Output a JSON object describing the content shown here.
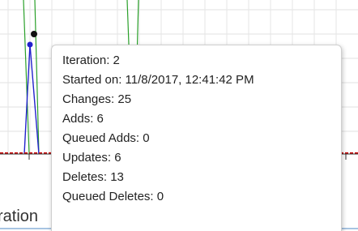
{
  "chart_data": {
    "type": "line",
    "xlabel": "Iteration",
    "series": [
      {
        "color": "#2222cc"
      },
      {
        "color": "#2aa02a"
      },
      {
        "color": "#cc1111"
      }
    ],
    "highlight_point_color": "#111111",
    "grid": true
  },
  "axis": {
    "x_title_visible": "ration"
  },
  "tooltip": {
    "rows": [
      "Iteration: 2",
      "Started on: 11/8/2017, 12:41:42 PM",
      "Changes: 25",
      "Adds: 6",
      "Queued Adds: 0",
      "Updates: 6",
      "Deletes: 13",
      "Queued Deletes: 0"
    ]
  }
}
